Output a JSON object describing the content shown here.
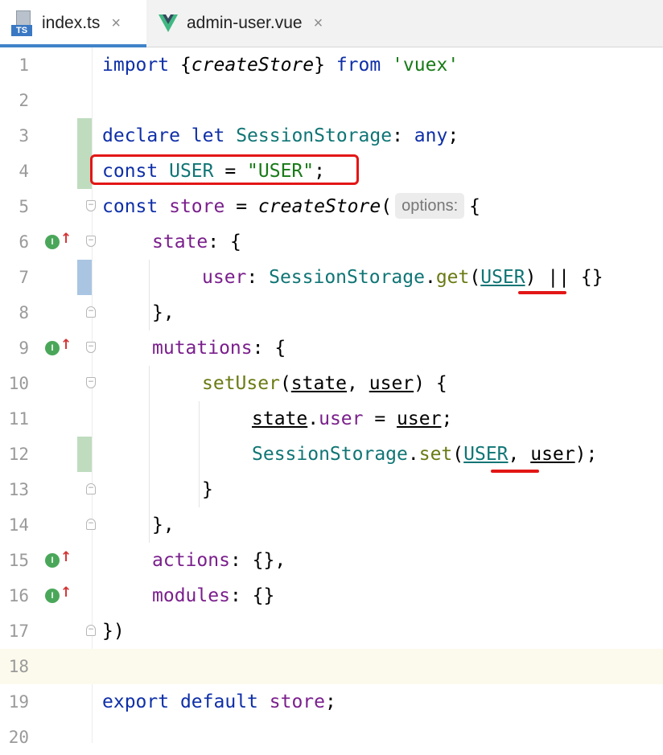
{
  "tabs": [
    {
      "label": "index.ts",
      "icon": "ts-file-icon",
      "icon_text": "TS",
      "active": true
    },
    {
      "label": "admin-user.vue",
      "icon": "vue-file-icon",
      "active": false
    }
  ],
  "tab_close_glyph": "×",
  "hint": "options:",
  "implement_marker": "I",
  "colors": {
    "keyword": "#0e2fa8",
    "string": "#177a17",
    "class": "#107575",
    "function": "#6b7a13",
    "property": "#7a1f8c",
    "annotation": "#e31616",
    "added": "#bfdcbf",
    "modified": "#a9c5e2",
    "current_line": "#fcfaed"
  },
  "line_numbers": [
    "1",
    "2",
    "3",
    "4",
    "5",
    "6",
    "7",
    "8",
    "9",
    "10",
    "11",
    "12",
    "13",
    "14",
    "15",
    "16",
    "17",
    "18",
    "19",
    "20"
  ],
  "code": {
    "l1": [
      "import",
      " {",
      "createStore",
      "} ",
      "from",
      " ",
      "'vuex'"
    ],
    "l3": [
      "declare",
      " ",
      "let",
      " ",
      "SessionStorage",
      ": ",
      "any",
      ";"
    ],
    "l4": [
      "const",
      " ",
      "USER",
      " = ",
      "\"USER\"",
      ";"
    ],
    "l5": [
      "const",
      " ",
      "store",
      " = ",
      "createStore",
      "(",
      "{"
    ],
    "l6": [
      "state",
      ": {"
    ],
    "l7": [
      "user",
      ": ",
      "SessionStorage",
      ".",
      "get",
      "(",
      "USER",
      ") || {}"
    ],
    "l8": [
      "},"
    ],
    "l9": [
      "mutations",
      ": {"
    ],
    "l10": [
      "setUser",
      "(",
      "state",
      ", ",
      "user",
      ") {"
    ],
    "l11": [
      "state",
      ".",
      "user",
      " = ",
      "user",
      ";"
    ],
    "l12": [
      "SessionStorage",
      ".",
      "set",
      "(",
      "USER",
      ", ",
      "user",
      ");"
    ],
    "l13": [
      "}"
    ],
    "l14": [
      "},"
    ],
    "l15": [
      "actions",
      ": {},"
    ],
    "l16": [
      "modules",
      ": {}"
    ],
    "l17": [
      "})"
    ],
    "l19": [
      "export",
      " ",
      "default",
      " ",
      "store",
      ";"
    ]
  }
}
